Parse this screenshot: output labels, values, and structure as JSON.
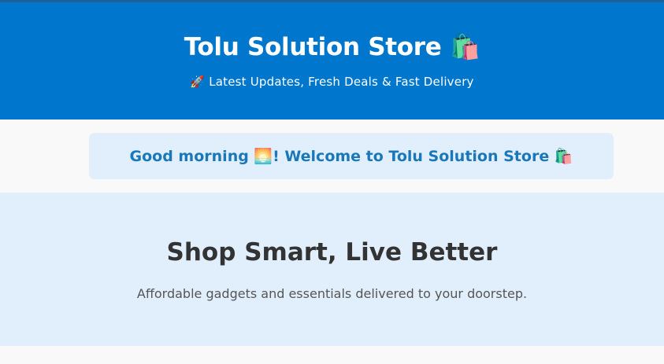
{
  "header": {
    "title": "Tolu Solution Store 🛍️",
    "tagline": "🚀 Latest Updates, Fresh Deals & Fast Delivery"
  },
  "greeting": {
    "text": "Good morning 🌅! Welcome to Tolu Solution Store 🛍️"
  },
  "hero": {
    "title": "Shop Smart, Live Better",
    "subtitle": "Affordable gadgets and essentials delivered to your doorstep."
  },
  "colors": {
    "header_bg": "#0077cc",
    "greeting_bg": "#e1effc",
    "greeting_text": "#1a78b8",
    "hero_bg": "#e1effd",
    "hero_title": "#333333"
  }
}
